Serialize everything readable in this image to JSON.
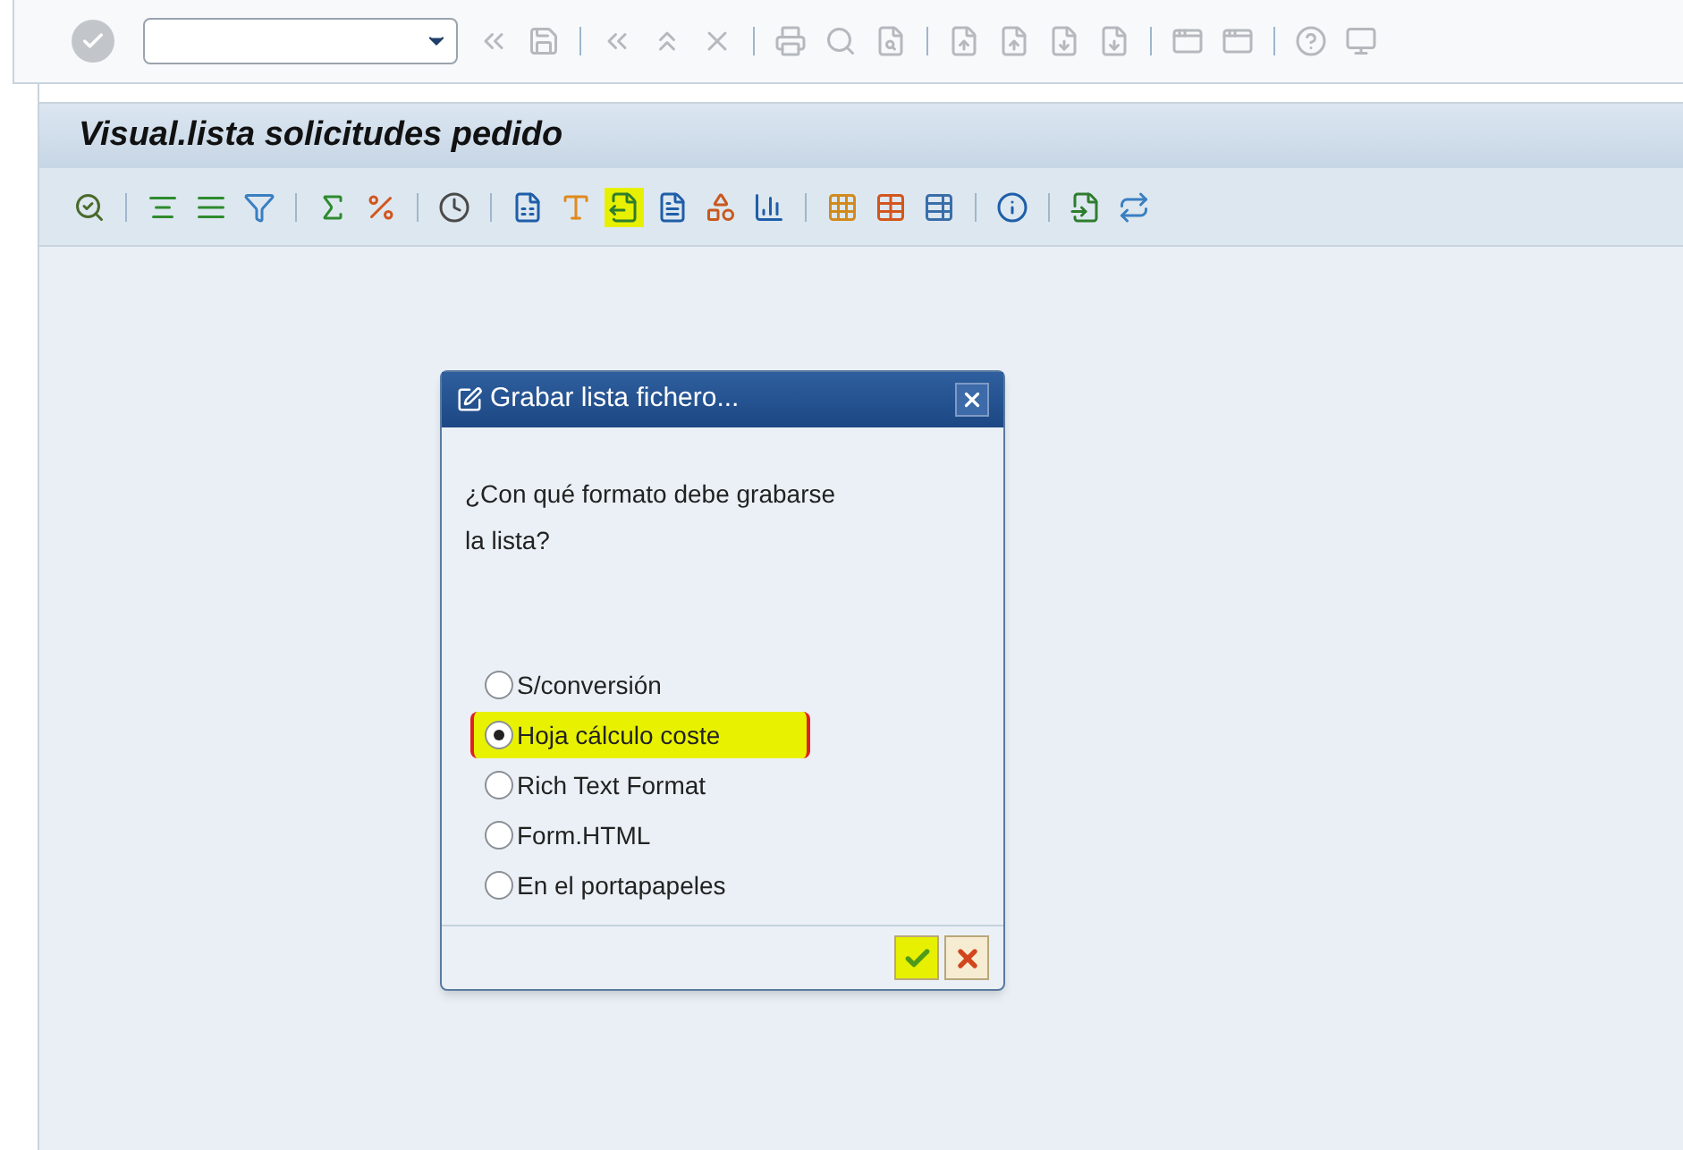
{
  "screen": {
    "title": "Visual.lista solicitudes pedido"
  },
  "app_toolbar": [
    [
      {
        "highlighted": false
      }
    ],
    [
      {
        "highlighted": false
      },
      {
        "highlighted": false
      },
      {
        "highlighted": false
      }
    ],
    [
      {
        "highlighted": false
      },
      {
        "highlighted": false
      }
    ],
    [
      {
        "highlighted": false
      }
    ],
    [
      {
        "highlighted": false
      },
      {
        "highlighted": false
      },
      {
        "highlighted": true
      },
      {
        "highlighted": false
      },
      {
        "highlighted": false
      },
      {
        "highlighted": false
      }
    ],
    [
      {
        "highlighted": false
      },
      {
        "highlighted": false
      },
      {
        "highlighted": false
      }
    ],
    [
      {
        "highlighted": false
      }
    ],
    [
      {
        "highlighted": false
      },
      {
        "highlighted": false
      }
    ]
  ],
  "dialog": {
    "title": "Grabar lista fichero...",
    "question": [
      "¿Con qué formato debe grabarse",
      "la lista?"
    ],
    "options": [
      {
        "label": "S/conversión",
        "selected": false,
        "highlighted": false
      },
      {
        "label": "Hoja cálculo coste",
        "selected": true,
        "highlighted": true
      },
      {
        "label": "Rich Text Format",
        "selected": false,
        "highlighted": false
      },
      {
        "label": "Form.HTML",
        "selected": false,
        "highlighted": false
      },
      {
        "label": "En el portapapeles",
        "selected": false,
        "highlighted": false
      }
    ],
    "buttons": [
      {
        "kind": "confirm",
        "highlighted": true
      },
      {
        "kind": "cancel",
        "highlighted": false
      }
    ]
  }
}
